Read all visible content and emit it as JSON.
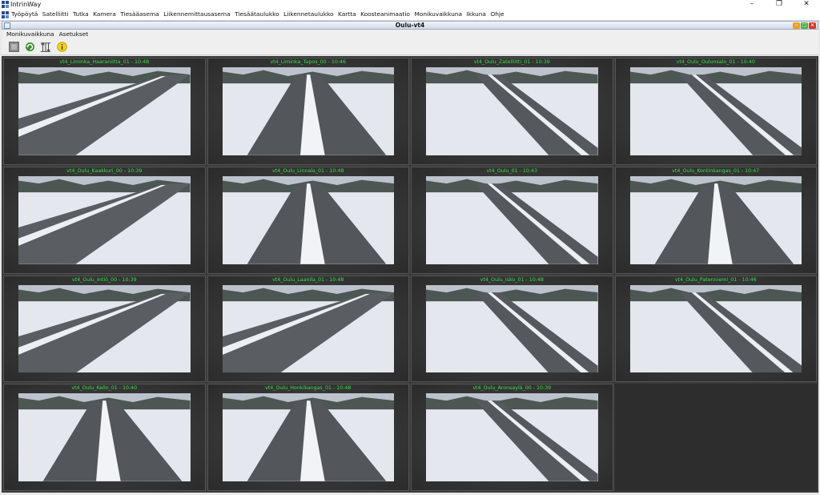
{
  "app": {
    "title": "IntrinWay"
  },
  "window_controls": [
    "–",
    "❐",
    "✕"
  ],
  "menu": [
    "Työpöytä",
    "Satelliitti",
    "Tutka",
    "Kamera",
    "Tiesääasema",
    "Liikennemittausasema",
    "Tiesäätaulukko",
    "Liikennetaulukko",
    "Kartta",
    "Koosteanimaatio",
    "Monikuvaikkuna",
    "Ikkuna",
    "Ohje"
  ],
  "frame": {
    "title": "Oulu-vt4"
  },
  "submenu": [
    "Monikuvaikkuna",
    "Asetukset"
  ],
  "toolbar": {
    "icons": [
      "stop-icon",
      "refresh-icon",
      "layout-icon",
      "info-icon"
    ]
  },
  "cameras": [
    {
      "label": "vt4_Liminka_Haaraniitta_01 - 10:48",
      "view": "left"
    },
    {
      "label": "vt4_Liminka_Tupos_00 - 10:46",
      "view": "center"
    },
    {
      "label": "vt4_Oulu_Zatelliitti_01 - 10:39",
      "view": "right"
    },
    {
      "label": "vt4_Oulu_Oulunsalo_01 - 10:40",
      "view": "right"
    },
    {
      "label": "vt4_Oulu_Kaakkuri_00 - 10:39",
      "view": "left"
    },
    {
      "label": "vt4_Oulu_Linnala_01 - 10:48",
      "view": "center"
    },
    {
      "label": "vt4_Oulu_01 - 10:43",
      "view": "right"
    },
    {
      "label": "vt4_Oulu_Kontinkangas_01 - 10:47",
      "view": "center"
    },
    {
      "label": "vt4_Oulu_Intiö_00 - 10:39",
      "view": "left"
    },
    {
      "label": "vt4_Oulu_Laanila_01 - 10:48",
      "view": "left"
    },
    {
      "label": "vt4_Oulu_Isko_01 - 10:48",
      "view": "right"
    },
    {
      "label": "vt4_Oulu_Patenniemi_01 - 10:46",
      "view": "right"
    },
    {
      "label": "vt4_Oulu_Kello_01 - 10:40",
      "view": "center"
    },
    {
      "label": "vt4_Oulu_Honkikangas_01 - 10:48",
      "view": "center"
    },
    {
      "label": "vt4_Oulu_Aronsaylä_00 - 10:39",
      "view": "right"
    }
  ]
}
